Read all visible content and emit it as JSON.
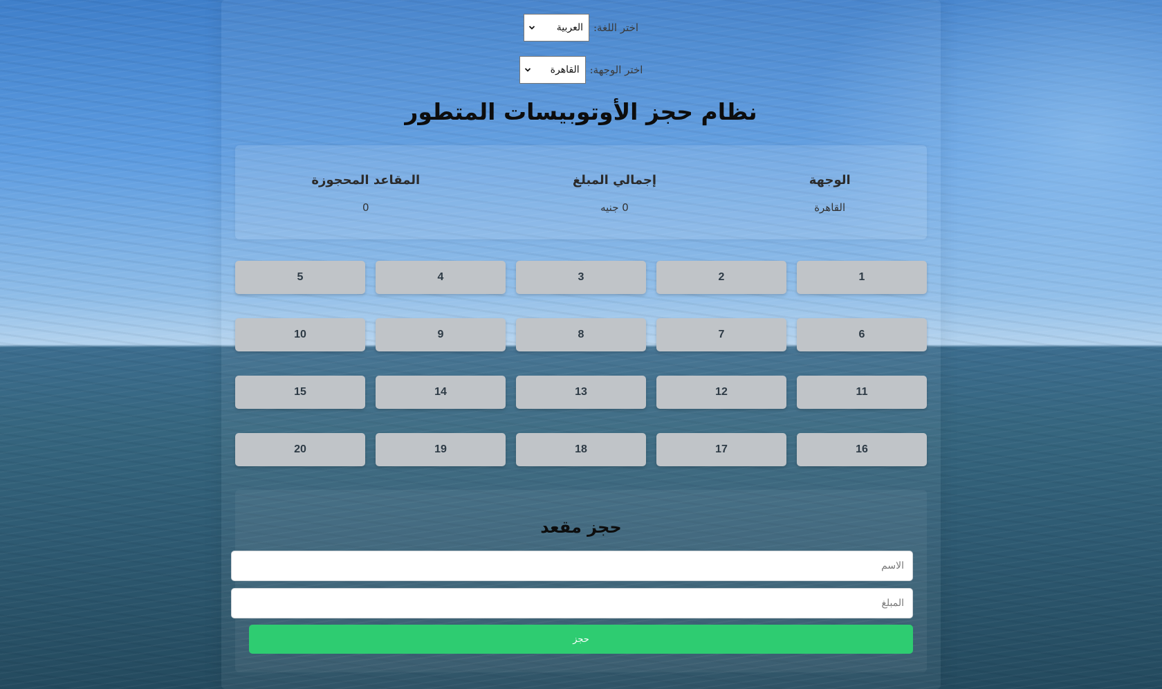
{
  "language_selector": {
    "label": "اختر اللغة:",
    "selected": "العربية"
  },
  "destination_selector": {
    "label": "اختر الوجهة:",
    "selected": "القاهرة"
  },
  "title": "نظام حجز الأوتوبيسات المتطور",
  "summary": {
    "booked_seats_label": "المقاعد المحجوزة",
    "booked_seats_value": "0",
    "total_amount_label": "إجمالي المبلغ",
    "total_amount_value": "0 جنيه",
    "destination_label": "الوجهة",
    "destination_value": "القاهرة"
  },
  "seats": [
    "1",
    "2",
    "3",
    "4",
    "5",
    "6",
    "7",
    "8",
    "9",
    "10",
    "11",
    "12",
    "13",
    "14",
    "15",
    "16",
    "17",
    "18",
    "19",
    "20"
  ],
  "booking_form": {
    "title": "حجز مقعد",
    "name_placeholder": "الاسم",
    "amount_placeholder": "المبلغ",
    "submit_label": "حجز"
  },
  "colors": {
    "seat_bg": "#c0c4c8",
    "submit_bg": "#2ecc71"
  },
  "icons": {
    "select_arrow": "chevron-down-icon"
  }
}
